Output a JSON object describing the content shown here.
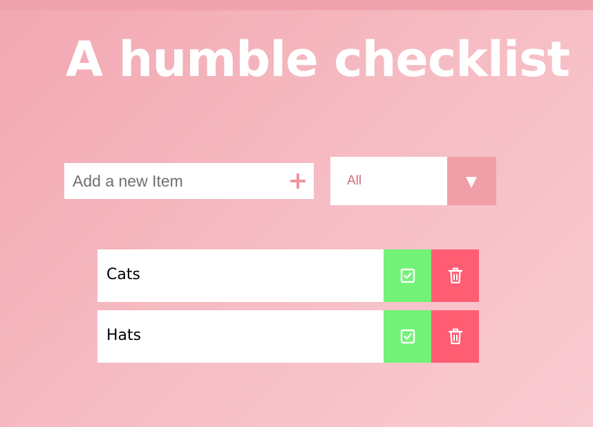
{
  "title": "A humble checklist",
  "add_form": {
    "placeholder": "Add a new Item",
    "add_icon": "plus-icon"
  },
  "filter": {
    "selected": "All",
    "arrow_icon": "caret-down-icon"
  },
  "todos": [
    {
      "text": "Cats",
      "complete_icon": "check-square-icon",
      "delete_icon": "trash-icon"
    },
    {
      "text": "Hats",
      "complete_icon": "check-square-icon",
      "delete_icon": "trash-icon"
    }
  ],
  "colors": {
    "background": "#f5b6be",
    "accent": "#f0949f",
    "complete": "#72f277",
    "delete": "#ff5d72",
    "filter_text": "#d06f7c"
  }
}
